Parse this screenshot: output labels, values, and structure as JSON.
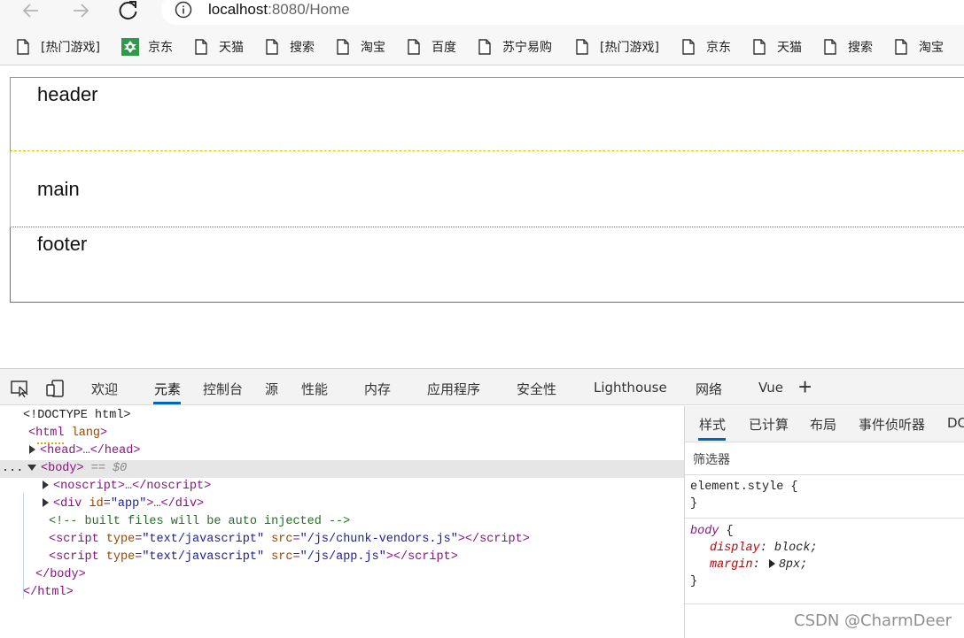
{
  "browser": {
    "url_host": "localhost",
    "url_path": ":8080/Home",
    "bookmarks": [
      {
        "label": "[热门游戏]",
        "icon": "page-icon"
      },
      {
        "label": "京东",
        "icon": "jd-icon"
      },
      {
        "label": "天猫",
        "icon": "page-icon"
      },
      {
        "label": "搜索",
        "icon": "page-icon"
      },
      {
        "label": "淘宝",
        "icon": "page-icon"
      },
      {
        "label": "百度",
        "icon": "page-icon"
      },
      {
        "label": "苏宁易购",
        "icon": "page-icon"
      },
      {
        "label": "[热门游戏]",
        "icon": "page-icon"
      },
      {
        "label": "京东",
        "icon": "page-icon"
      },
      {
        "label": "天猫",
        "icon": "page-icon"
      },
      {
        "label": "搜索",
        "icon": "page-icon"
      },
      {
        "label": "淘宝",
        "icon": "page-icon"
      }
    ]
  },
  "page": {
    "header": "header",
    "main": "main",
    "footer": "footer"
  },
  "devtools": {
    "tabs": [
      "欢迎",
      "元素",
      "控制台",
      "源",
      "性能",
      "内存",
      "应用程序",
      "安全性",
      "Lighthouse",
      "网络",
      "Vue"
    ],
    "active_tab": "元素",
    "more_tabs": "+",
    "dom": {
      "doctype": "<!DOCTYPE html>",
      "html_open_tag": "<html",
      "html_open_attr": "lang",
      "html_open_end": ">",
      "head": "<head>…</head>",
      "body_open": "<body>",
      "body_marker": "== $0",
      "noscript": "<noscript>…</noscript>",
      "div_open": "<div ",
      "div_attr_name": "id",
      "div_attr_val": "\"app\"",
      "div_close": ">…</div>",
      "comment": "<!-- built files will be auto injected -->",
      "script1_attr_type_val": "\"text/javascript\"",
      "script1_attr_src_val": "\"/js/chunk-vendors.js\"",
      "script2_attr_type_val": "\"text/javascript\"",
      "script2_attr_src_val": "\"/js/app.js\"",
      "body_close": "</body>",
      "html_close": "</html>",
      "ellipsis": "..."
    },
    "styles": {
      "tabs": [
        "样式",
        "已计算",
        "布局",
        "事件侦听器",
        "DC"
      ],
      "active_tab": "样式",
      "filter_placeholder": "筛选器",
      "element_style_open": "element.style {",
      "close_brace": "}",
      "body_selector": "body",
      "body_open": " {",
      "prop1": "display",
      "val1": "block;",
      "prop2": "margin",
      "val2": "8px;"
    }
  },
  "watermark": "CSDN @CharmDeer"
}
